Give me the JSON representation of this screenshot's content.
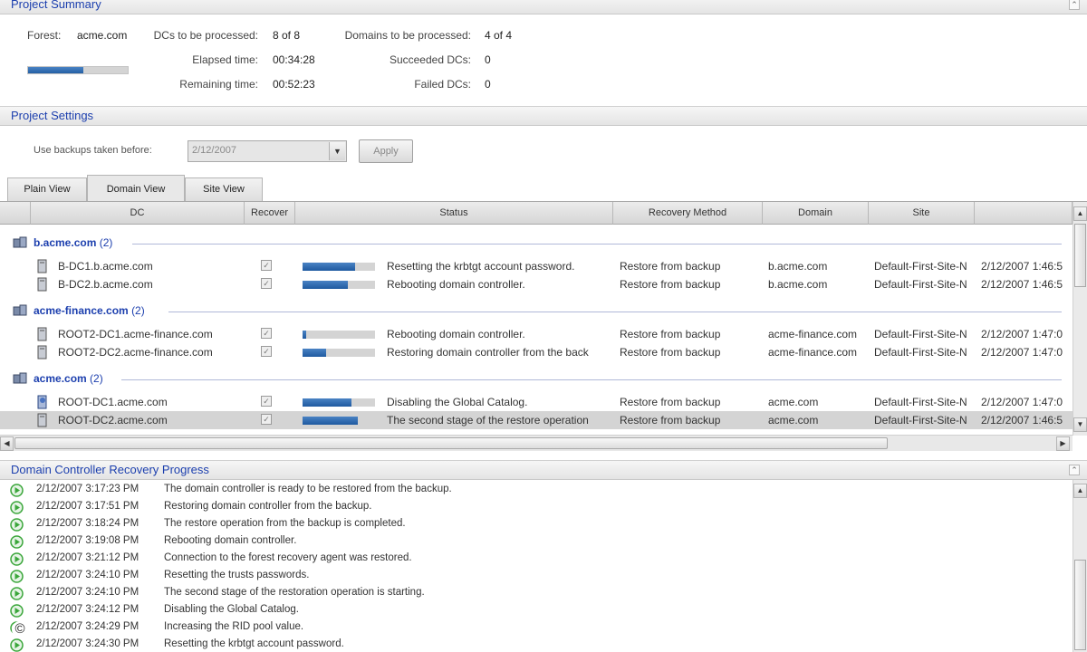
{
  "project_summary": {
    "title": "Project Summary",
    "forest_label": "Forest:",
    "forest_value": "acme.com",
    "dcs_label": "DCs to be processed:",
    "dcs_value": "8 of 8",
    "domains_label": "Domains to be processed:",
    "domains_value": "4 of 4",
    "elapsed_label": "Elapsed time:",
    "elapsed_value": "00:34:28",
    "succeeded_label": "Succeeded DCs:",
    "succeeded_value": "0",
    "remaining_label": "Remaining time:",
    "remaining_value": "00:52:23",
    "failed_label": "Failed DCs:",
    "failed_value": "0",
    "overall_progress": 0.55
  },
  "project_settings": {
    "title": "Project Settings",
    "backup_label": "Use backups taken before:",
    "backup_date": "2/12/2007",
    "apply_label": "Apply"
  },
  "tabs": [
    {
      "label": "Plain View"
    },
    {
      "label": "Domain View"
    },
    {
      "label": "Site View"
    }
  ],
  "active_tab": "Domain View",
  "columns": {
    "dc": "DC",
    "recover": "Recover",
    "status": "Status",
    "method": "Recovery Method",
    "domain": "Domain",
    "site": "Site",
    "extra": ""
  },
  "groups": [
    {
      "name": "b.acme.com",
      "count": "(2)",
      "rows": [
        {
          "dc": "B-DC1.b.acme.com",
          "progress": 0.72,
          "status": "Resetting the krbtgt account password.",
          "method": "Restore from backup",
          "domain": "b.acme.com",
          "site": "Default-First-Site-N",
          "time": "2/12/2007 1:46:5"
        },
        {
          "dc": "B-DC2.b.acme.com",
          "progress": 0.62,
          "status": "Rebooting domain controller.",
          "method": "Restore from backup",
          "domain": "b.acme.com",
          "site": "Default-First-Site-N",
          "time": "2/12/2007 1:46:5"
        }
      ]
    },
    {
      "name": "acme-finance.com",
      "count": "(2)",
      "rows": [
        {
          "dc": "ROOT2-DC1.acme-finance.com",
          "progress": 0.05,
          "status": "Rebooting domain controller.",
          "method": "Restore from backup",
          "domain": "acme-finance.com",
          "site": "Default-First-Site-N",
          "time": "2/12/2007 1:47:0"
        },
        {
          "dc": "ROOT2-DC2.acme-finance.com",
          "progress": 0.33,
          "status": "Restoring domain controller from the back",
          "method": "Restore from backup",
          "domain": "acme-finance.com",
          "site": "Default-First-Site-N",
          "time": "2/12/2007 1:47:0"
        }
      ]
    },
    {
      "name": "acme.com",
      "count": "(2)",
      "rows": [
        {
          "dc": "ROOT-DC1.acme.com",
          "progress": 0.68,
          "status": "Disabling the Global Catalog.",
          "method": "Restore from backup",
          "domain": "acme.com",
          "site": "Default-First-Site-N",
          "time": "2/12/2007 1:47:0"
        },
        {
          "dc": "ROOT-DC2.acme.com",
          "progress": 0.76,
          "status": "The second stage of the restore operation",
          "method": "Restore from backup",
          "domain": "acme.com",
          "site": "Default-First-Site-N",
          "time": "2/12/2007 1:46:5"
        }
      ]
    }
  ],
  "recovery_progress": {
    "title": "Domain Controller Recovery Progress",
    "entries": [
      {
        "time": "2/12/2007 3:17:23 PM",
        "message": "The domain controller is ready to be restored from the backup."
      },
      {
        "time": "2/12/2007 3:17:51 PM",
        "message": "Restoring domain controller from the backup."
      },
      {
        "time": "2/12/2007 3:18:24 PM",
        "message": "The restore operation from the backup is completed."
      },
      {
        "time": "2/12/2007 3:19:08 PM",
        "message": "Rebooting domain controller."
      },
      {
        "time": "2/12/2007 3:21:12 PM",
        "message": "Connection to the forest recovery agent was restored."
      },
      {
        "time": "2/12/2007 3:24:10 PM",
        "message": "Resetting the trusts passwords."
      },
      {
        "time": "2/12/2007 3:24:10 PM",
        "message": "The second stage of the restoration operation is starting."
      },
      {
        "time": "2/12/2007 3:24:12 PM",
        "message": "Disabling the Global Catalog."
      },
      {
        "time": "2/12/2007 3:24:29 PM",
        "message": "Increasing the RID pool value."
      },
      {
        "time": "2/12/2007 3:24:30 PM",
        "message": "Resetting the krbtgt account password."
      }
    ]
  },
  "copyright_symbol": "©",
  "colors": {
    "accent": "#1c3fae",
    "progress": "#245fa4",
    "log_icon": "#3aa63a"
  }
}
